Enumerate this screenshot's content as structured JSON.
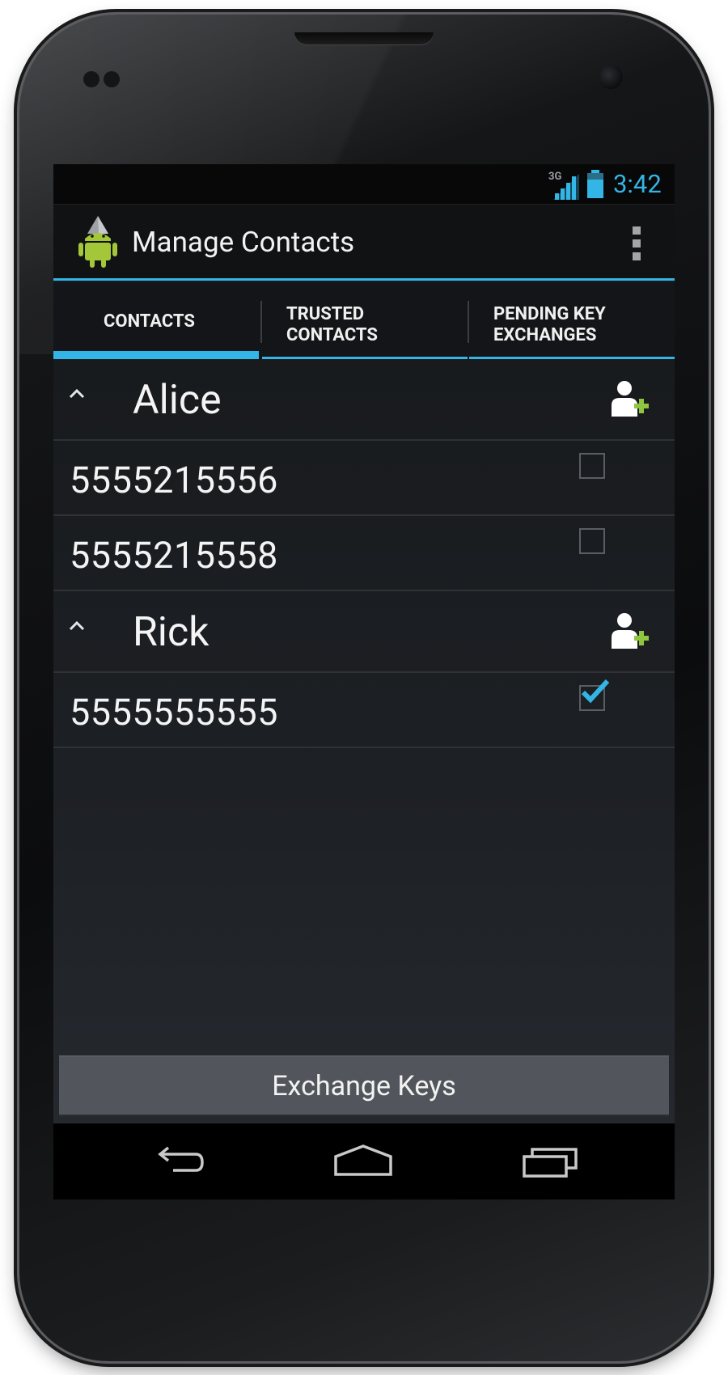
{
  "status_bar": {
    "network_type": "3G",
    "time": "3:42"
  },
  "action_bar": {
    "title": "Manage Contacts",
    "app_icon": "android-wizard-icon",
    "overflow_icon": "overflow-menu-icon"
  },
  "tabs": [
    {
      "label": "CONTACTS",
      "selected": true
    },
    {
      "label": "TRUSTED CONTACTS",
      "selected": false
    },
    {
      "label": "PENDING KEY EXCHANGES",
      "selected": false
    }
  ],
  "contacts": [
    {
      "name": "Alice",
      "expanded": true,
      "numbers": [
        {
          "number": "5555215556",
          "checked": false
        },
        {
          "number": "5555215558",
          "checked": false
        }
      ]
    },
    {
      "name": "Rick",
      "expanded": true,
      "numbers": [
        {
          "number": "5555555555",
          "checked": true
        }
      ]
    }
  ],
  "exchange_button": {
    "label": "Exchange Keys"
  },
  "colors": {
    "accent": "#33b5e5",
    "add_icon_green": "#8ec63f",
    "android_green": "#a4c639"
  },
  "nav_bar": {
    "back_icon": "back-icon",
    "home_icon": "home-icon",
    "recent_icon": "recent-apps-icon"
  }
}
